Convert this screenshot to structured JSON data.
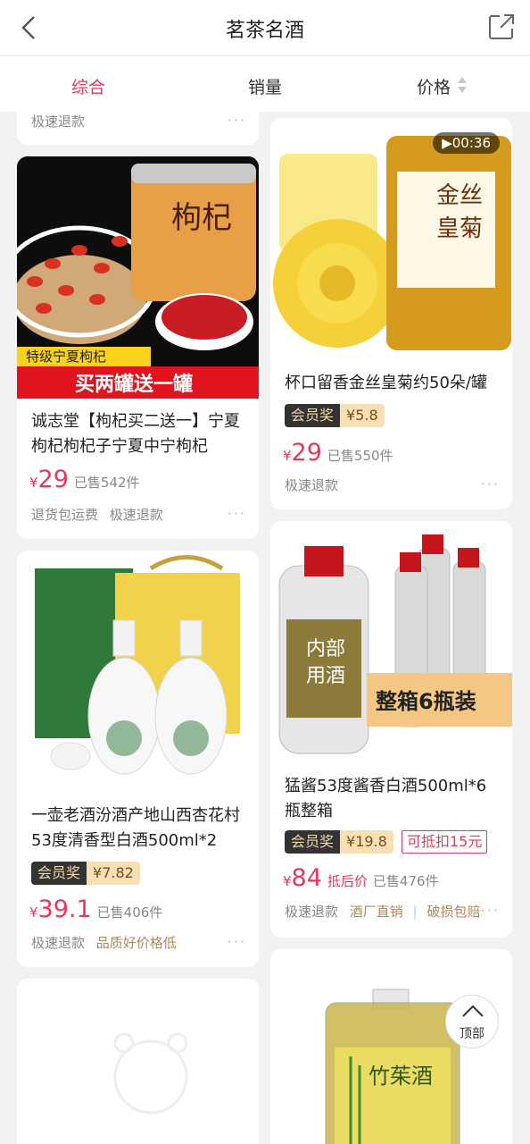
{
  "header": {
    "title": "茗茶名酒"
  },
  "tabs": [
    {
      "label": "综合"
    },
    {
      "label": "销量"
    },
    {
      "label": "价格"
    }
  ],
  "cards": {
    "top_partial": {
      "tag": "极速退款"
    },
    "goji": {
      "image_banner_top": "特级宁夏枸杞",
      "image_banner_bottom": "买两罐送一罐",
      "image_can_text": "枸杞",
      "title": "诚志堂【枸杞买二送一】宁夏枸杞枸杞子宁夏中宁枸杞",
      "price": "29",
      "sold": "已售542件",
      "tags": [
        "退货包运费",
        "极速退款"
      ]
    },
    "chrysanthemum": {
      "video_duration": "00:36",
      "image_can_text": "金丝皇菊",
      "title": "杯口留香金丝皇菊约50朵/罐",
      "member_label": "会员奖",
      "member_price": "¥5.8",
      "price": "29",
      "sold": "已售550件",
      "tags": [
        "极速退款"
      ]
    },
    "fenjiu": {
      "title": "一壶老酒汾酒产地山西杏花村53度清香型白酒500ml*2",
      "member_label": "会员奖",
      "member_price": "¥7.82",
      "price": "39.1",
      "sold": "已售406件",
      "tags": [
        "极速退款"
      ],
      "gold_tags": [
        "品质好价格低"
      ]
    },
    "maotai": {
      "image_banner": "整箱6瓶装",
      "title": "猛酱53度酱香白酒500ml*6瓶整箱",
      "member_label": "会员奖",
      "member_price": "¥19.8",
      "coupon": "可抵扣15元",
      "price": "84",
      "after_label": "抵后价",
      "sold": "已售476件",
      "tags": [
        "极速退款"
      ],
      "gold_tags": [
        "酒厂直销",
        "破损包赔"
      ]
    },
    "zhuye": {
      "image_label": "竹茱酒"
    }
  },
  "yen_symbol": "¥",
  "more": "···",
  "back_to_top": "顶部",
  "colors": {
    "accent": "#e8385a",
    "member_dark": "#333333",
    "member_gold": "#f9e0b4",
    "tag_gold": "#b0895a"
  }
}
